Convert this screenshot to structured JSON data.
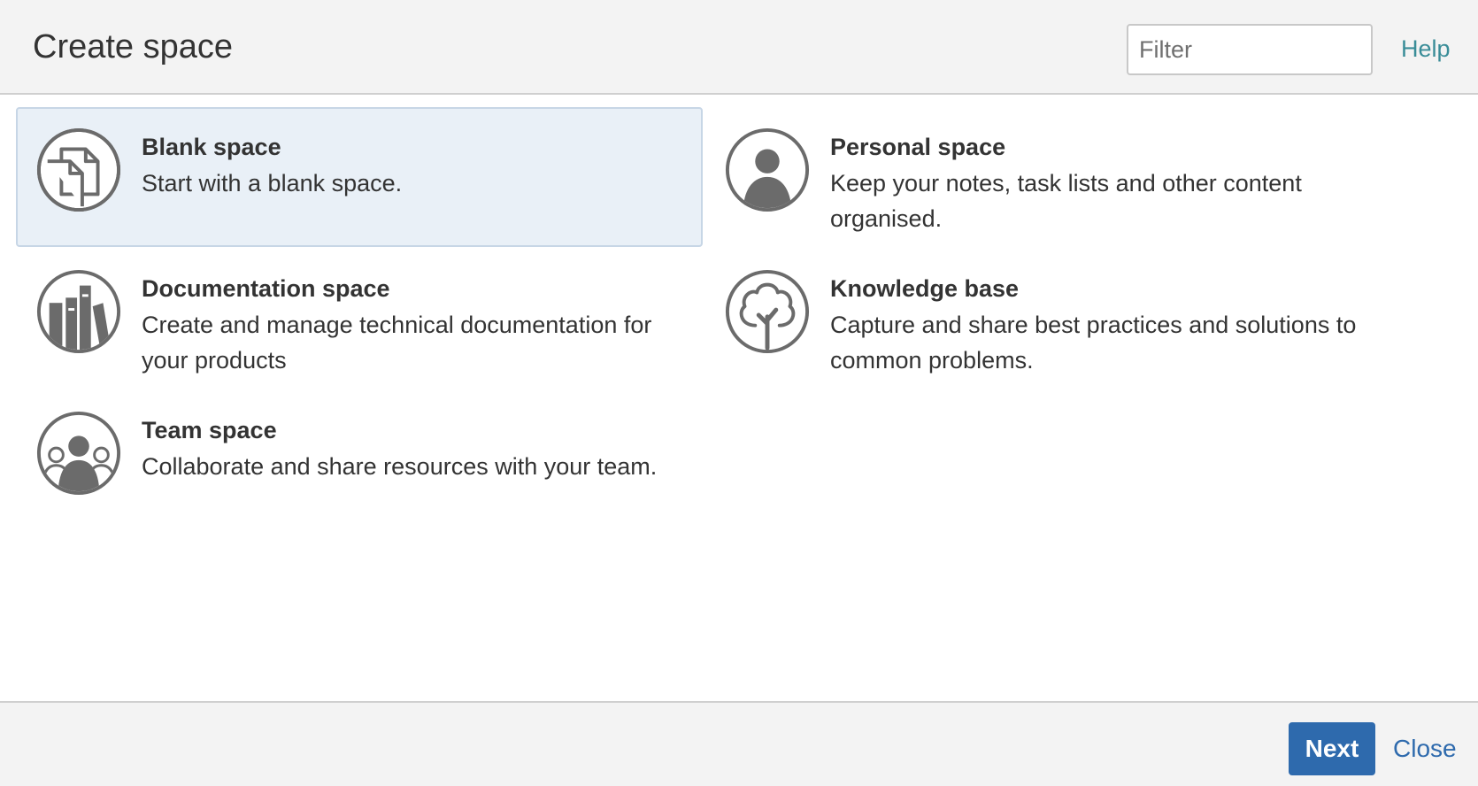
{
  "header": {
    "title": "Create space",
    "filter_placeholder": "Filter",
    "filter_value": "",
    "help_label": "Help"
  },
  "templates": [
    {
      "name": "Blank space",
      "description": "Start with a blank space.",
      "icon": "blank-page-icon",
      "selected": true
    },
    {
      "name": "Personal space",
      "description": "Keep your notes, task lists and other content organised.",
      "icon": "person-icon",
      "selected": false
    },
    {
      "name": "Documentation space",
      "description": "Create and manage technical documentation for your products",
      "icon": "books-icon",
      "selected": false
    },
    {
      "name": "Knowledge base",
      "description": "Capture and share best practices and solutions to common problems.",
      "icon": "tree-icon",
      "selected": false
    },
    {
      "name": "Team space",
      "description": "Collaborate and share resources with your team.",
      "icon": "team-icon",
      "selected": false
    }
  ],
  "footer": {
    "next_label": "Next",
    "close_label": "Close"
  },
  "colors": {
    "primary_button": "#2e6aad",
    "link": "#2e6aad",
    "help_link": "#3a8d98",
    "selected_background": "#e9f0f7",
    "icon_gray": "#6b6b6b"
  }
}
